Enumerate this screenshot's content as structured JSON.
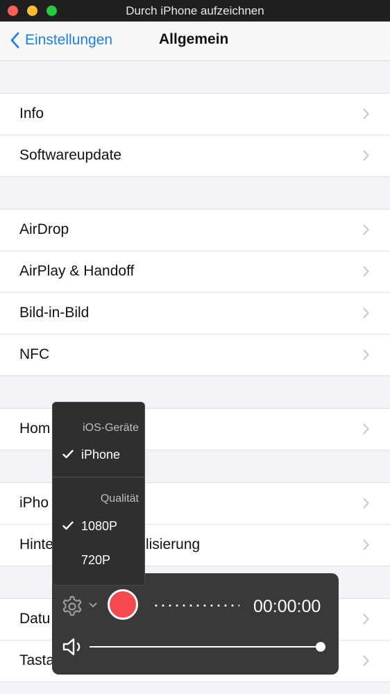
{
  "window": {
    "title": "Durch iPhone aufzeichnen",
    "traffic_lights": {
      "close": "#fe5f57",
      "minimize": "#febc2e",
      "zoom": "#28c840"
    }
  },
  "nav": {
    "back_label": "Einstellungen",
    "title": "Allgemein",
    "accent": "#1a7fe6"
  },
  "groups": [
    {
      "rows": [
        "Info",
        "Softwareupdate"
      ]
    },
    {
      "rows": [
        "AirDrop",
        "AirPlay & Handoff",
        "Bild-in-Bild",
        "NFC"
      ]
    },
    {
      "rows": [
        "Hom"
      ]
    },
    {
      "rows": [
        "iPho",
        "Hinte"
      ],
      "row_suffix": {
        "1": "lisierung"
      }
    },
    {
      "rows": [
        "Datu",
        "Tasta"
      ]
    }
  ],
  "menu": {
    "devices_header": "iOS-Geräte",
    "device_selected": "iPhone",
    "quality_header": "Qualität",
    "quality_options": [
      "1080P",
      "720P"
    ],
    "quality_selected_index": 0
  },
  "controls": {
    "timer": "00:00:00",
    "record_color": "#f5484f",
    "volume_level": 1.0,
    "icons": [
      "gear-icon",
      "chevron-down-icon",
      "record-button",
      "speaker-icon"
    ]
  }
}
